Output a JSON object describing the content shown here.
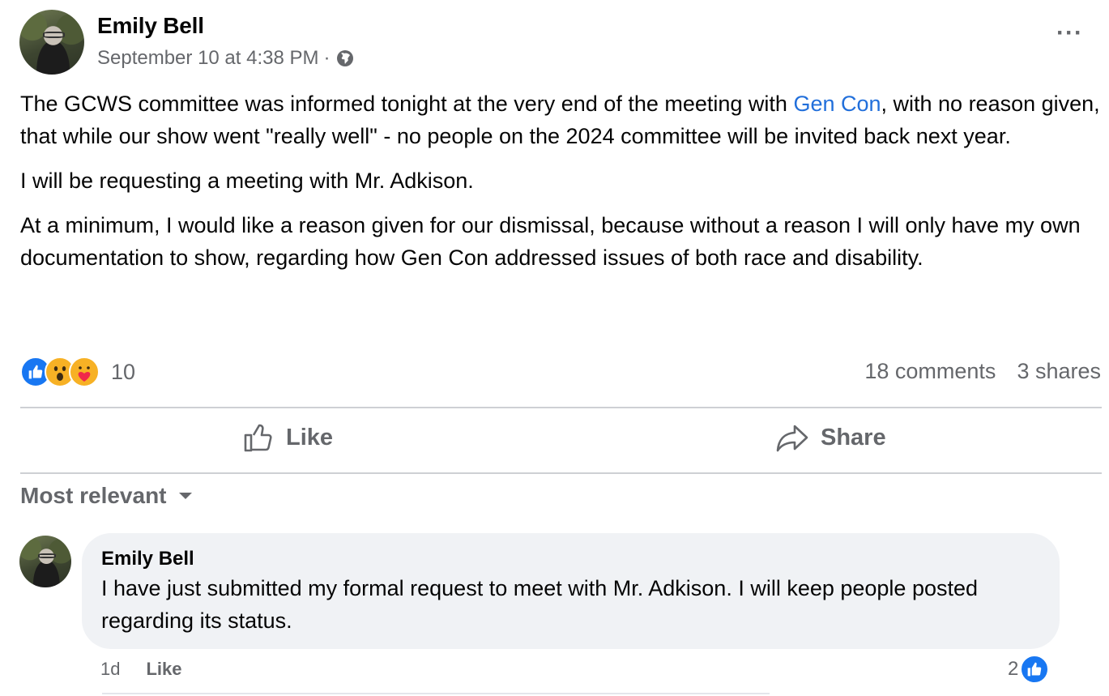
{
  "post": {
    "author": "Emily Bell",
    "timestamp": "September 10 at 4:38 PM",
    "separator": "·",
    "privacy_icon": "globe-icon",
    "more_label": "···",
    "paragraph1_before": "The GCWS committee was informed tonight at the very end of the meeting with ",
    "paragraph1_link": "Gen Con",
    "paragraph1_after": ", with no reason given, that while our show went \"really well\" - no people on the 2024 committee will be invited back next year.",
    "paragraph2": "I will be requesting a meeting with Mr. Adkison.",
    "paragraph3": "At a minimum, I would like a reason given for our dismissal, because without a reason I will only have my own documentation to show, regarding how Gen Con addressed issues of both race and disability.",
    "reactions": [
      "like-icon",
      "wow-icon",
      "care-icon"
    ],
    "reaction_count": "10",
    "comments_count": "18 comments",
    "shares_count": "3 shares"
  },
  "actions": {
    "like_label": "Like",
    "share_label": "Share"
  },
  "comments_sort": {
    "label": "Most relevant"
  },
  "comment": {
    "author": "Emily Bell",
    "text": "I have just submitted my formal request to meet with Mr. Adkison. I will keep people posted regarding its status.",
    "age": "1d",
    "like_label": "Like",
    "reaction_count": "2"
  },
  "colors": {
    "link": "#216fdb",
    "meta": "#65676b",
    "like_blue": "#1877f2",
    "bubble": "#f0f2f5"
  }
}
